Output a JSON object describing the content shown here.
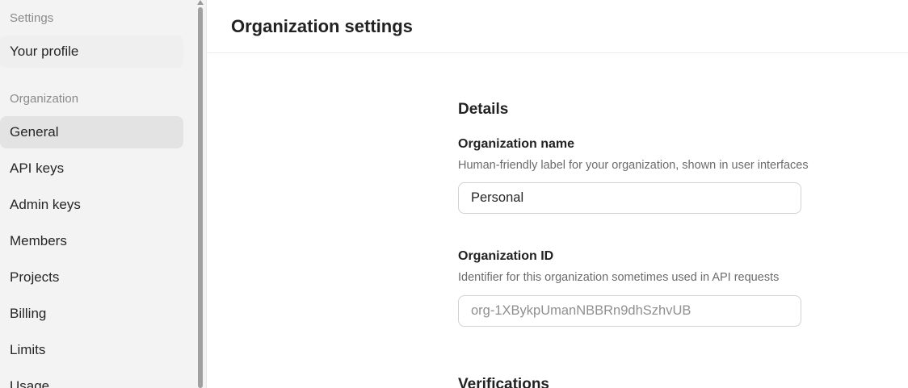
{
  "sidebar": {
    "settings_heading": "Settings",
    "profile_item": "Your profile",
    "organization_heading": "Organization",
    "items": [
      {
        "label": "General",
        "active": true
      },
      {
        "label": "API keys"
      },
      {
        "label": "Admin keys"
      },
      {
        "label": "Members"
      },
      {
        "label": "Projects"
      },
      {
        "label": "Billing"
      },
      {
        "label": "Limits"
      },
      {
        "label": "Usage"
      }
    ]
  },
  "header": {
    "title": "Organization settings"
  },
  "details": {
    "title": "Details",
    "org_name": {
      "label": "Organization name",
      "help": "Human-friendly label for your organization, shown in user interfaces",
      "value": "Personal"
    },
    "org_id": {
      "label": "Organization ID",
      "help": "Identifier for this organization sometimes used in API requests",
      "value": "org-1XBykpUmanNBBRn9dhSzhvUB"
    }
  },
  "verifications": {
    "title": "Verifications"
  }
}
